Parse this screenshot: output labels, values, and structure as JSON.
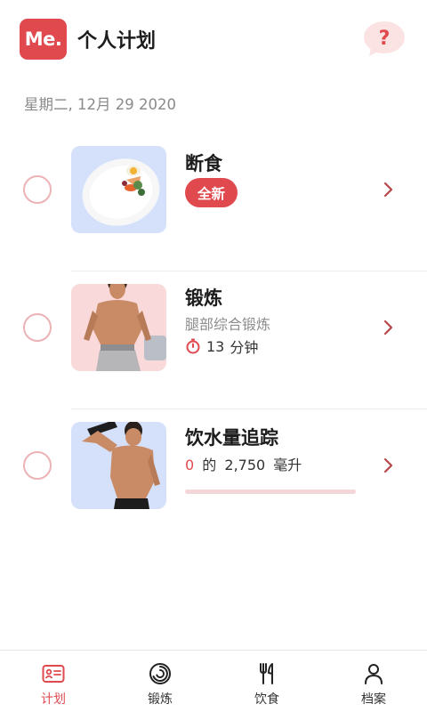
{
  "header": {
    "logo_text": "Me.",
    "title": "个人计划",
    "help_icon": "question-bubble-icon"
  },
  "date": "星期二, 12月 29 2020",
  "plans": [
    {
      "title": "断食",
      "badge": "全新",
      "thumb_icon": "meal-plate-image"
    },
    {
      "title": "锻炼",
      "subtitle": "腿部综合锻炼",
      "duration_value": "13",
      "duration_unit": "分钟",
      "thumb_icon": "man-workout-image"
    },
    {
      "title": "饮水量追踪",
      "water_current": "0",
      "water_of": "的",
      "water_goal": "2,750",
      "water_unit": "毫升",
      "progress_fraction": 0.0,
      "thumb_icon": "man-drinking-image"
    }
  ],
  "tabs": [
    {
      "label": "计划",
      "icon": "id-card-icon",
      "active": true
    },
    {
      "label": "锻炼",
      "icon": "fitness-ring-icon",
      "active": false
    },
    {
      "label": "饮食",
      "icon": "fork-knife-icon",
      "active": false
    },
    {
      "label": "档案",
      "icon": "person-icon",
      "active": false
    }
  ],
  "colors": {
    "accent": "#e04a4f",
    "check_border": "#ecb2b5",
    "thumb_blue": "#d5e0fb",
    "thumb_pink": "#fad9db",
    "muted_text": "#8a8a8a"
  }
}
